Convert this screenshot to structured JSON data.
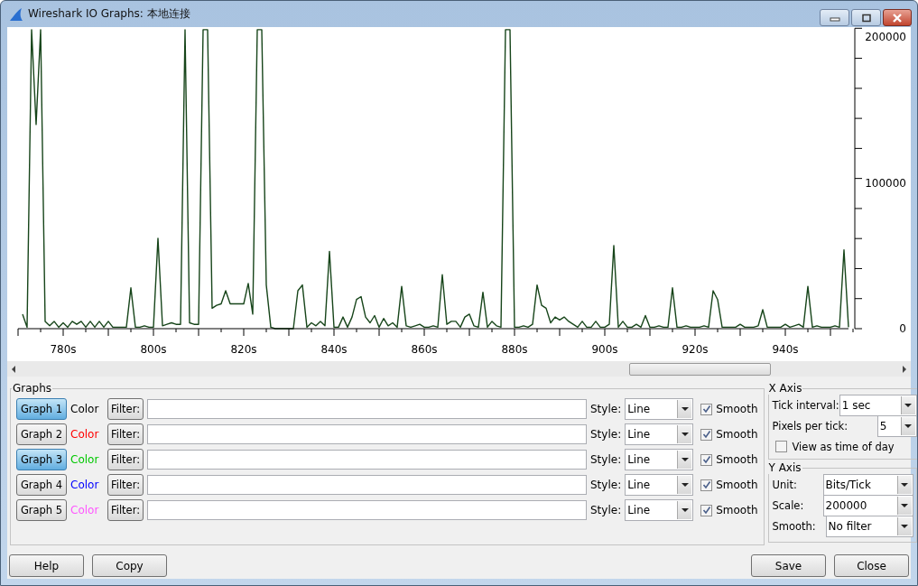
{
  "window": {
    "title": "Wireshark IO Graphs: 本地连接"
  },
  "chart": {
    "chart_data": {
      "type": "line",
      "xlim": [
        770,
        955
      ],
      "ylim": [
        0,
        206000
      ],
      "xticks": [
        {
          "value": 780,
          "label": "780s"
        },
        {
          "value": 800,
          "label": "800s"
        },
        {
          "value": 820,
          "label": "820s"
        },
        {
          "value": 840,
          "label": "840s"
        },
        {
          "value": 860,
          "label": "860s"
        },
        {
          "value": 880,
          "label": "880s"
        },
        {
          "value": 900,
          "label": "900s"
        },
        {
          "value": 920,
          "label": "920s"
        },
        {
          "value": 940,
          "label": "940s"
        }
      ],
      "yticks": [
        0,
        100000,
        200000
      ],
      "x": [
        771,
        772,
        773,
        774,
        775,
        776,
        777,
        778,
        779,
        780,
        781,
        782,
        783,
        784,
        785,
        786,
        787,
        788,
        789,
        790,
        791,
        792,
        793,
        794,
        795,
        796,
        797,
        798,
        799,
        800,
        801,
        802,
        803,
        804,
        805,
        806,
        807,
        808,
        809,
        810,
        811,
        812,
        813,
        814,
        815,
        816,
        817,
        818,
        819,
        820,
        821,
        822,
        823,
        824,
        825,
        826,
        827,
        828,
        829,
        830,
        831,
        832,
        833,
        834,
        835,
        836,
        837,
        838,
        839,
        840,
        841,
        842,
        843,
        844,
        845,
        846,
        847,
        848,
        849,
        850,
        851,
        852,
        853,
        854,
        855,
        856,
        857,
        858,
        859,
        860,
        861,
        862,
        863,
        864,
        865,
        866,
        867,
        868,
        869,
        870,
        871,
        872,
        873,
        874,
        875,
        876,
        877,
        878,
        879,
        880,
        881,
        882,
        883,
        884,
        885,
        886,
        887,
        888,
        889,
        890,
        891,
        892,
        893,
        894,
        895,
        896,
        897,
        898,
        899,
        900,
        901,
        902,
        903,
        904,
        905,
        906,
        907,
        908,
        909,
        910,
        911,
        912,
        913,
        914,
        915,
        916,
        917,
        918,
        919,
        920,
        921,
        922,
        923,
        924,
        925,
        926,
        927,
        928,
        929,
        930,
        931,
        932,
        933,
        934,
        935,
        936,
        937,
        938,
        939,
        940,
        941,
        942,
        943,
        944,
        945,
        946,
        947,
        948,
        949,
        950,
        951,
        952,
        953,
        954
      ],
      "series": [
        {
          "color": "#17451a",
          "values": [
            10000,
            1000,
            205000,
            140000,
            205000,
            5000,
            2000,
            5000,
            1000,
            4000,
            1000,
            5000,
            3000,
            5000,
            1000,
            5000,
            1000,
            5000,
            1000,
            5000,
            1000,
            1000,
            1000,
            1000,
            28000,
            1000,
            1000,
            2000,
            1000,
            1000,
            62000,
            2000,
            3000,
            4000,
            3000,
            3000,
            205000,
            4000,
            3000,
            3000,
            205000,
            205000,
            14000,
            16000,
            17000,
            26000,
            17000,
            17000,
            17000,
            17000,
            31000,
            10000,
            205000,
            205000,
            30000,
            1000,
            0,
            0,
            0,
            0,
            0,
            26000,
            30000,
            1000,
            4000,
            2000,
            5000,
            2000,
            53000,
            1000,
            1000,
            8000,
            1000,
            8000,
            20000,
            22000,
            8000,
            4000,
            9000,
            1000,
            7000,
            2000,
            4000,
            1000,
            29000,
            2000,
            1000,
            2000,
            3000,
            1000,
            1000,
            2000,
            1000,
            37000,
            3000,
            5000,
            5000,
            1000,
            8000,
            10000,
            2000,
            1000,
            25000,
            1000,
            5000,
            2000,
            1000,
            205000,
            205000,
            1000,
            1000,
            2000,
            1000,
            3000,
            30000,
            16000,
            14000,
            4000,
            8000,
            6000,
            8000,
            5000,
            3000,
            1000,
            5000,
            1000,
            1000,
            5000,
            1000,
            1000,
            3000,
            57000,
            1000,
            5000,
            1000,
            1000,
            3000,
            1000,
            9000,
            1000,
            1000,
            2000,
            1000,
            1000,
            28000,
            1000,
            1000,
            2000,
            1000,
            1000,
            1000,
            2000,
            1000,
            26000,
            20000,
            1000,
            1000,
            1000,
            1000,
            3000,
            1000,
            1000,
            1000,
            2000,
            13000,
            1000,
            1000,
            1000,
            1000,
            3000,
            1000,
            2000,
            3000,
            1000,
            29000,
            1000,
            2000,
            1000,
            1000,
            1000,
            2000,
            1000,
            54000,
            1000
          ]
        }
      ]
    }
  },
  "graphs": {
    "legend": "Graphs",
    "rows": [
      {
        "button": "Graph 1",
        "selected": true,
        "color_label": "Color",
        "color": "#000000",
        "filter_button": "Filter:",
        "style_label": "Style:",
        "style": "Line",
        "smooth_label": "Smooth",
        "smooth": true
      },
      {
        "button": "Graph 2",
        "selected": false,
        "color_label": "Color",
        "color": "#ff0000",
        "filter_button": "Filter:",
        "style_label": "Style:",
        "style": "Line",
        "smooth_label": "Smooth",
        "smooth": true
      },
      {
        "button": "Graph 3",
        "selected": true,
        "color_label": "Color",
        "color": "#00c800",
        "filter_button": "Filter:",
        "style_label": "Style:",
        "style": "Line",
        "smooth_label": "Smooth",
        "smooth": true
      },
      {
        "button": "Graph 4",
        "selected": false,
        "color_label": "Color",
        "color": "#0000ff",
        "filter_button": "Filter:",
        "style_label": "Style:",
        "style": "Line",
        "smooth_label": "Smooth",
        "smooth": true
      },
      {
        "button": "Graph 5",
        "selected": false,
        "color_label": "Color",
        "color": "#ff55ff",
        "filter_button": "Filter:",
        "style_label": "Style:",
        "style": "Line",
        "smooth_label": "Smooth",
        "smooth": true
      }
    ]
  },
  "x_axis": {
    "legend": "X Axis",
    "tick_interval_label": "Tick interval:",
    "tick_interval": "1 sec",
    "pixels_label": "Pixels per tick:",
    "pixels": "5",
    "time_of_day": {
      "label": "View as time of day",
      "checked": false
    }
  },
  "y_axis": {
    "legend": "Y Axis",
    "unit_label": "Unit:",
    "unit": "Bits/Tick",
    "scale_label": "Scale:",
    "scale": "200000",
    "smooth_label": "Smooth:",
    "smooth": "No filter"
  },
  "buttons_left": [
    "Help",
    "Copy"
  ],
  "buttons_right": [
    "Save",
    "Close"
  ]
}
